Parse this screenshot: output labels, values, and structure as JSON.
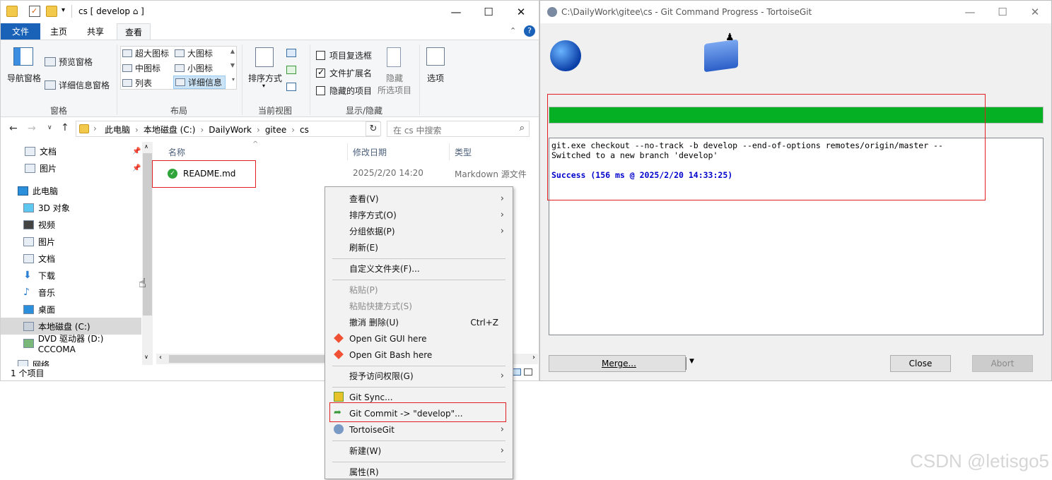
{
  "explorer": {
    "title": "cs [ develop ⌂ ]",
    "tabs": {
      "file": "文件",
      "home": "主页",
      "share": "共享",
      "view": "查看"
    },
    "ribbon": {
      "pane": {
        "nav": "导航窗格",
        "preview": "预览窗格",
        "details": "详细信息窗格",
        "label": "窗格"
      },
      "layout": {
        "xl": "超大图标",
        "large": "大图标",
        "medium": "中图标",
        "small": "小图标",
        "list": "列表",
        "details": "详细信息",
        "label": "布局"
      },
      "view": {
        "sort": "排序方式",
        "label": "当前视图"
      },
      "show": {
        "checkbox": "项目复选框",
        "ext": "文件扩展名",
        "hidden": "隐藏的项目",
        "hide": "隐藏",
        "hide2": "所选项目",
        "label": "显示/隐藏",
        "checkbox_checked": false,
        "ext_checked": true,
        "hidden_checked": false
      },
      "options": "选项"
    },
    "breadcrumb": [
      "此电脑",
      "本地磁盘 (C:)",
      "DailyWork",
      "gitee",
      "cs"
    ],
    "search_placeholder": "在 cs 中搜索",
    "nav": {
      "docs": "文档",
      "pics": "图片",
      "pc": "此电脑",
      "obj3d": "3D 对象",
      "video": "视频",
      "pics2": "图片",
      "docs2": "文档",
      "dl": "下载",
      "music": "音乐",
      "desktop": "桌面",
      "cdrive": "本地磁盘 (C:)",
      "dvd": "DVD 驱动器 (D:) CCCOMA",
      "net": "网络"
    },
    "columns": {
      "name": "名称",
      "date": "修改日期",
      "type": "类型"
    },
    "file": {
      "name": "README.md",
      "date": "2025/2/20 14:20",
      "type": "Markdown 源文件"
    },
    "status": "1 个项目"
  },
  "menu": {
    "view": "查看(V)",
    "sort": "排序方式(O)",
    "group": "分组依据(P)",
    "refresh": "刷新(E)",
    "customize": "自定义文件夹(F)...",
    "paste": "粘贴(P)",
    "paste_shortcut": "粘贴快捷方式(S)",
    "undo": "撤消 删除(U)",
    "undo_shortcut": "Ctrl+Z",
    "git_gui": "Open Git GUI here",
    "git_bash": "Open Git Bash here",
    "access": "授予访问权限(G)",
    "git_sync": "Git Sync...",
    "git_commit": "Git Commit -> \"develop\"...",
    "tortoise": "TortoiseGit",
    "new": "新建(W)",
    "props": "属性(R)"
  },
  "git": {
    "title": "C:\\DailyWork\\gitee\\cs - Git Command Progress - TortoiseGit",
    "progress": 1.0,
    "log1": "git.exe checkout --no-track -b develop --end-of-options remotes/origin/master --",
    "log2": "Switched to a new branch 'develop'",
    "log3": "Success (156 ms @ 2025/2/20 14:33:25)",
    "merge": "Merge...",
    "close": "Close",
    "abort": "Abort"
  },
  "watermark": "CSDN @letisgo5",
  "colors": {
    "accent": "#1a62b8",
    "progress": "#06b025",
    "success": "#0000cc",
    "highlight": "#e02020"
  }
}
